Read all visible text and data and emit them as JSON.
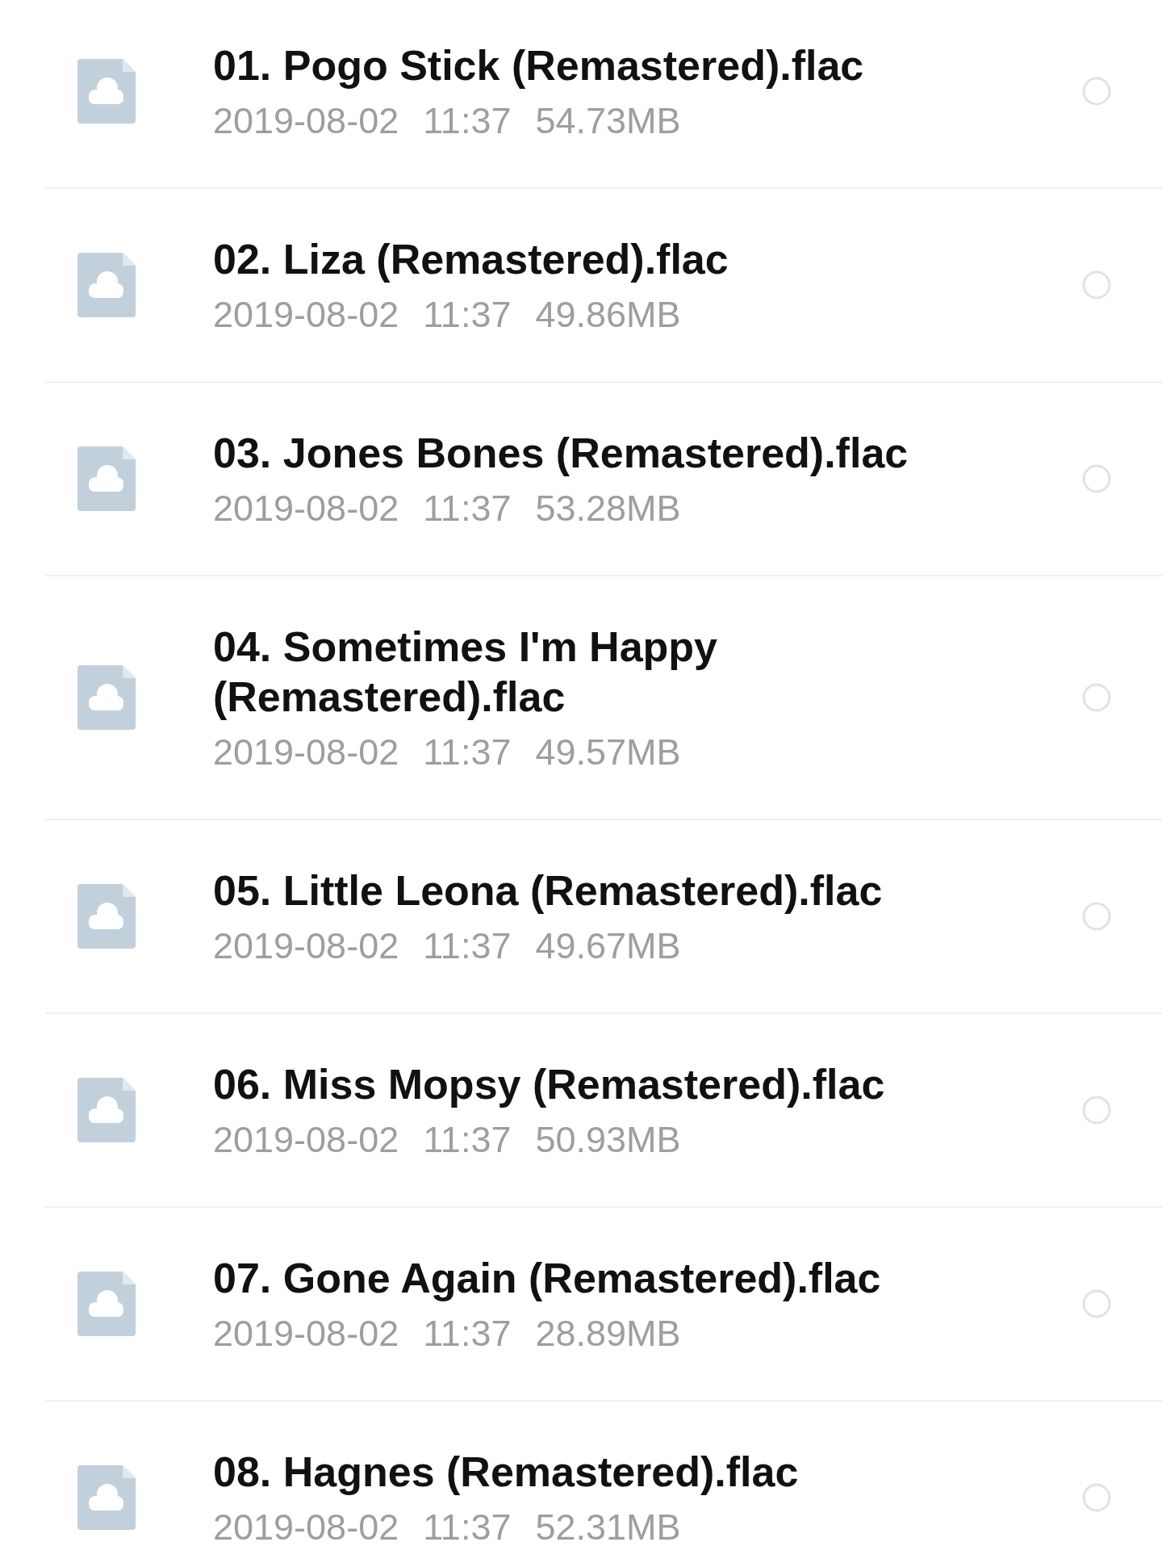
{
  "files": [
    {
      "name": "01. Pogo Stick (Remastered).flac",
      "date": "2019-08-02",
      "time": "11:37",
      "size": "54.73MB",
      "selected": false
    },
    {
      "name": "02. Liza (Remastered).flac",
      "date": "2019-08-02",
      "time": "11:37",
      "size": "49.86MB",
      "selected": false
    },
    {
      "name": "03. Jones Bones (Remastered).flac",
      "date": "2019-08-02",
      "time": "11:37",
      "size": "53.28MB",
      "selected": false
    },
    {
      "name": "04. Sometimes I'm Happy (Remastered).flac",
      "date": "2019-08-02",
      "time": "11:37",
      "size": "49.57MB",
      "selected": false
    },
    {
      "name": "05. Little Leona (Remastered).flac",
      "date": "2019-08-02",
      "time": "11:37",
      "size": "49.67MB",
      "selected": false
    },
    {
      "name": "06. Miss Mopsy (Remastered).flac",
      "date": "2019-08-02",
      "time": "11:37",
      "size": "50.93MB",
      "selected": false
    },
    {
      "name": "07. Gone Again (Remastered).flac",
      "date": "2019-08-02",
      "time": "11:37",
      "size": "28.89MB",
      "selected": false
    },
    {
      "name": "08. Hagnes (Remastered).flac",
      "date": "2019-08-02",
      "time": "11:37",
      "size": "52.31MB",
      "selected": false
    }
  ]
}
